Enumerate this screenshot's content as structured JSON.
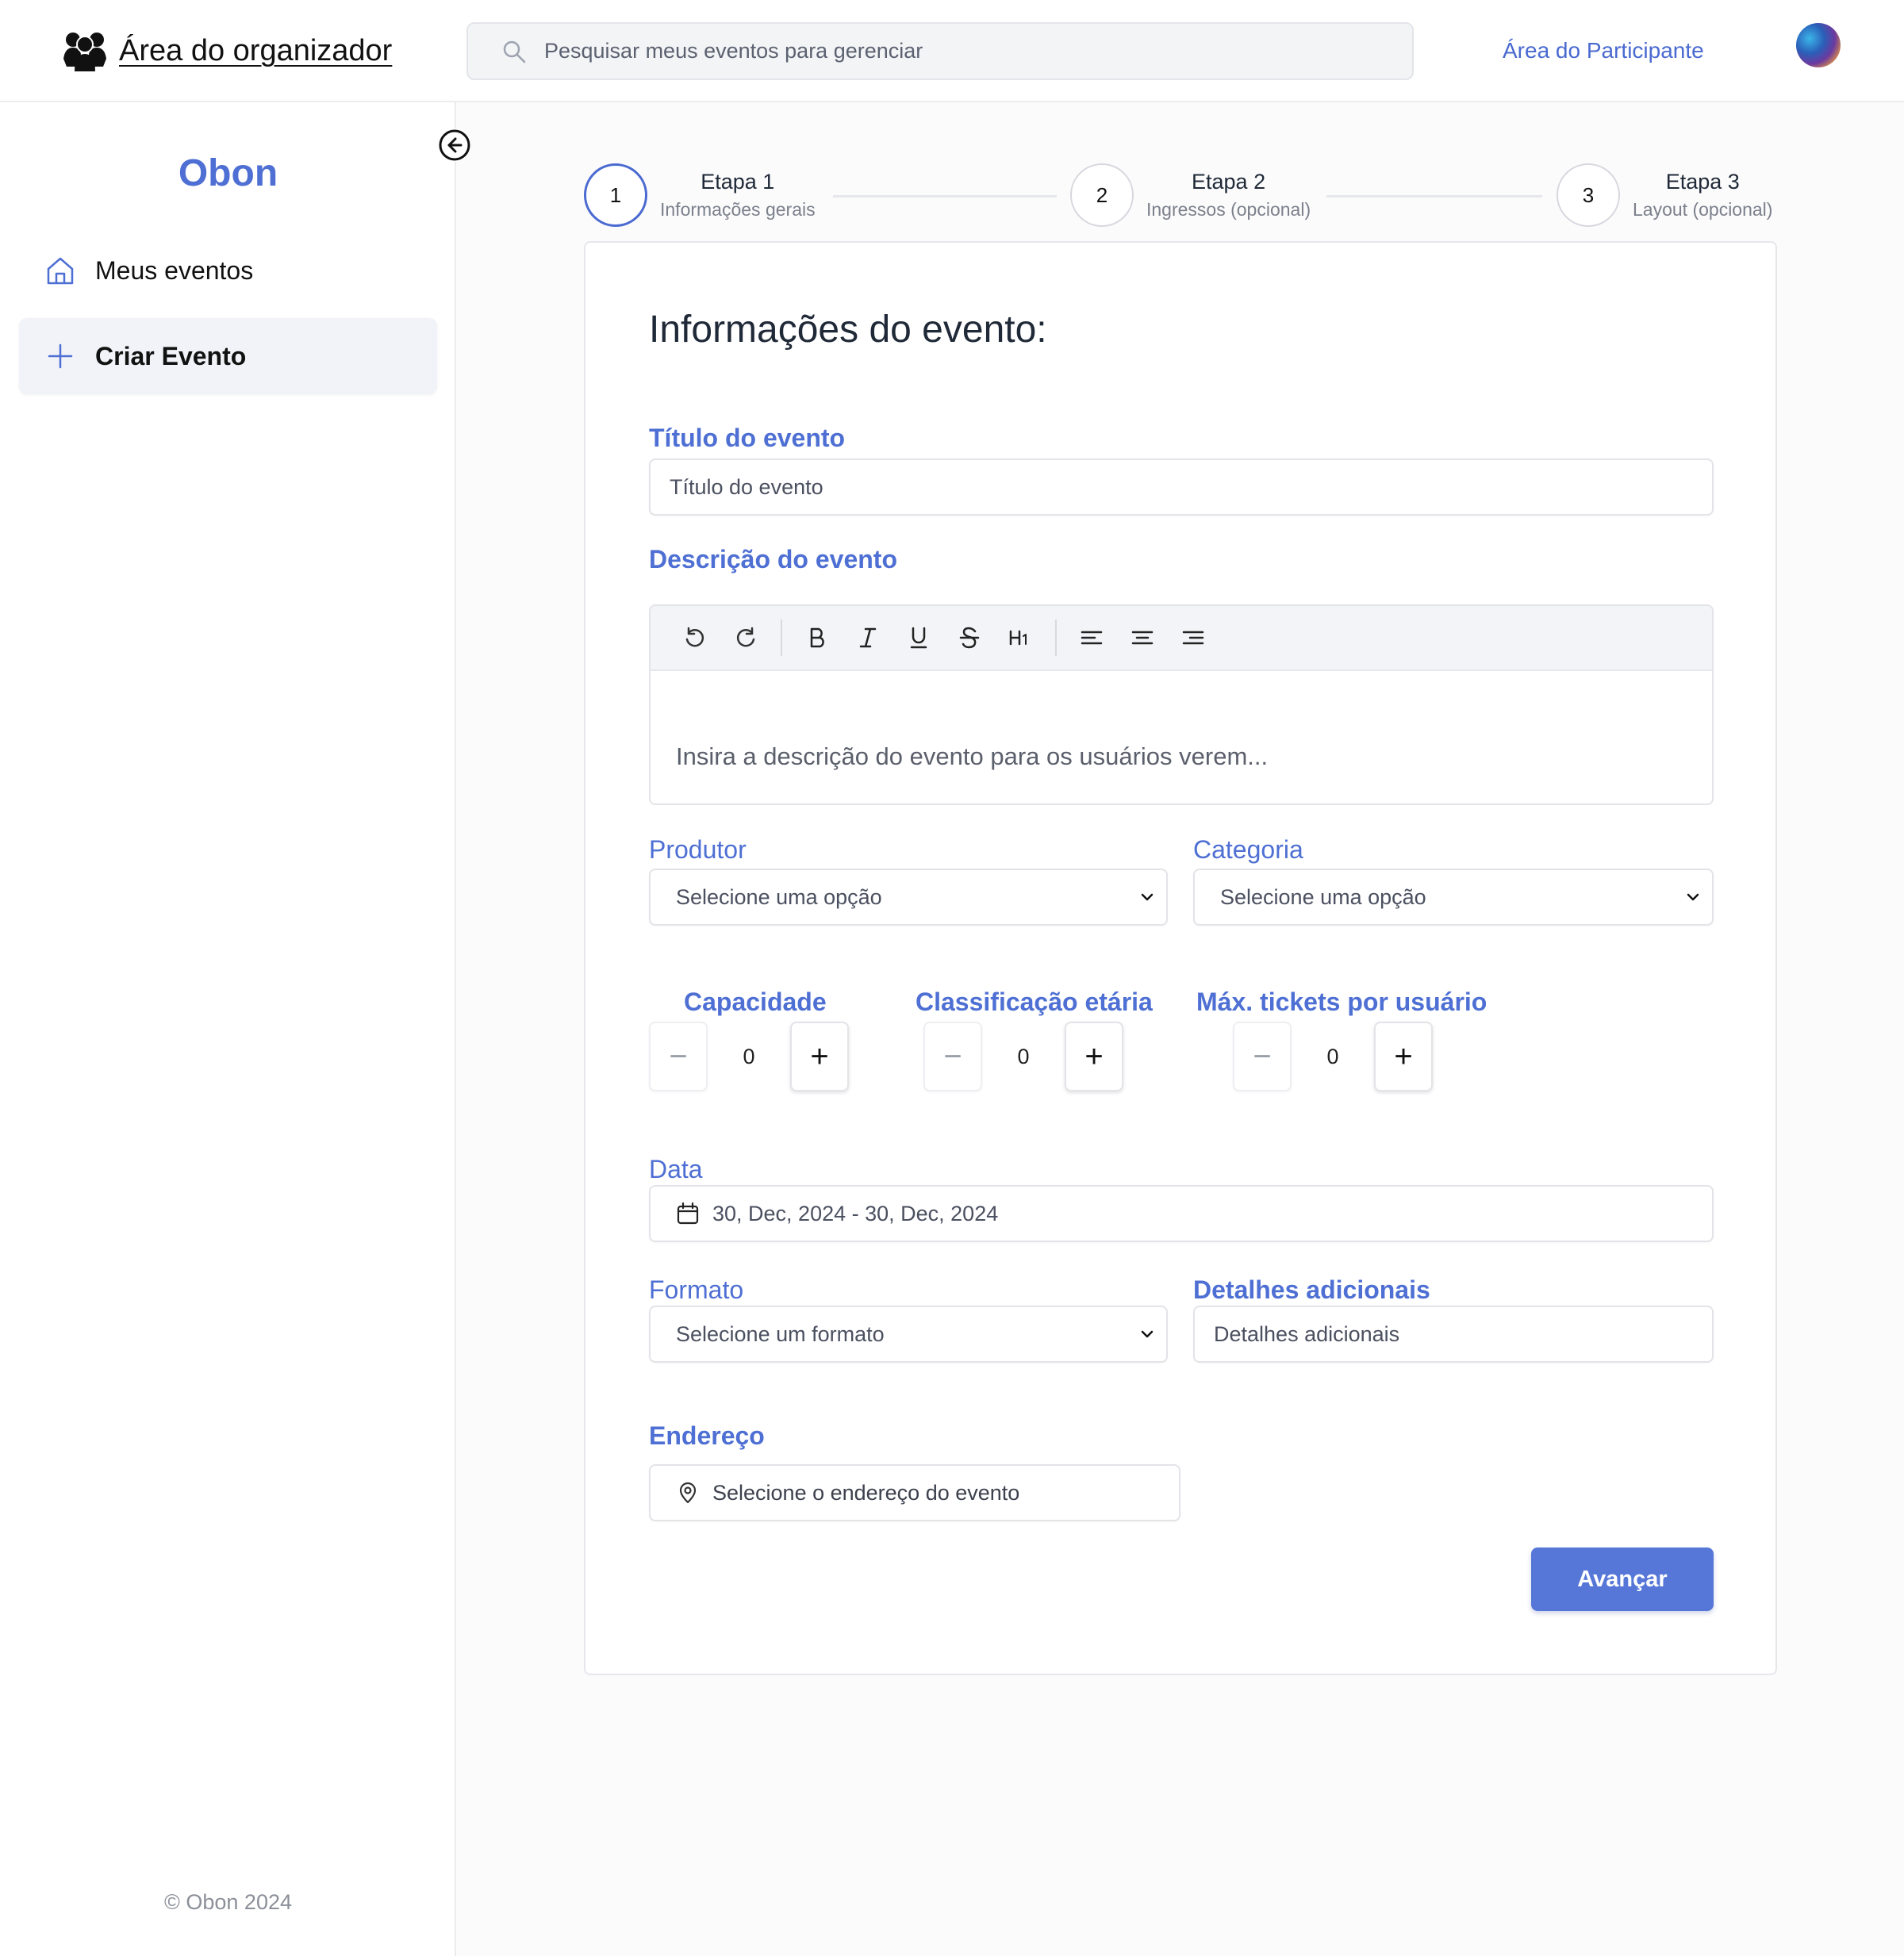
{
  "header": {
    "title": "Área do organizador",
    "search_placeholder": "Pesquisar meus eventos para gerenciar",
    "participant_link": "Área do Participante"
  },
  "sidebar": {
    "logo": "Obon",
    "items": [
      {
        "label": "Meus eventos",
        "icon": "home-icon"
      },
      {
        "label": "Criar Evento",
        "icon": "plus-icon",
        "active": true
      }
    ],
    "copyright": "© Obon 2024"
  },
  "stepper": [
    {
      "number": "1",
      "title": "Etapa 1",
      "subtitle": "Informações gerais",
      "active": true
    },
    {
      "number": "2",
      "title": "Etapa 2",
      "subtitle": "Ingressos (opcional)"
    },
    {
      "number": "3",
      "title": "Etapa 3",
      "subtitle": "Layout (opcional)"
    }
  ],
  "form": {
    "heading": "Informações do evento:",
    "title_label": "Título do evento",
    "title_placeholder": "Título do evento",
    "description_label": "Descrição do evento",
    "description_placeholder": "Insira a descrição do evento para os usuários verem...",
    "producer_label": "Produtor",
    "producer_value": "Selecione uma opção",
    "category_label": "Categoria",
    "category_value": "Selecione uma opção",
    "capacity_label": "Capacidade",
    "capacity_value": "0",
    "age_label": "Classificação etária",
    "age_value": "0",
    "max_tickets_label": "Máx. tickets por usuário",
    "max_tickets_value": "0",
    "date_label": "Data",
    "date_value": "30, Dec, 2024 - 30, Dec, 2024",
    "format_label": "Formato",
    "format_value": "Selecione um formato",
    "details_label": "Detalhes adicionais",
    "details_placeholder": "Detalhes adicionais",
    "address_label": "Endereço",
    "address_value": "Selecione o endereço do evento",
    "next_button": "Avançar"
  },
  "toolbar_icons": [
    "undo-icon",
    "redo-icon",
    "bold-icon",
    "italic-icon",
    "underline-icon",
    "strikethrough-icon",
    "heading1-icon",
    "align-left-icon",
    "align-center-icon",
    "align-right-icon"
  ],
  "colors": {
    "accent": "#4e6fd3",
    "button": "#5677d8",
    "link": "#4a6ad0"
  }
}
